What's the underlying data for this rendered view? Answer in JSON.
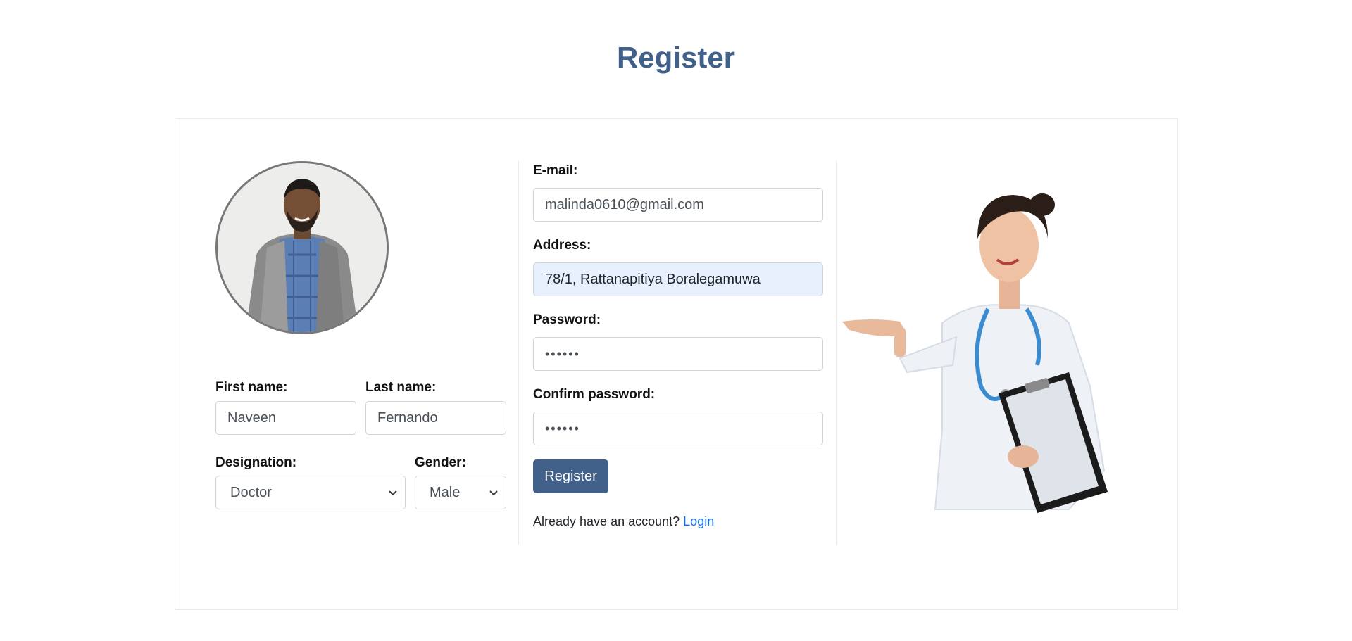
{
  "header": {
    "title": "Register"
  },
  "profile": {
    "first_name_label": "First name:",
    "first_name_value": "Naveen",
    "last_name_label": "Last name:",
    "last_name_value": "Fernando",
    "designation_label": "Designation:",
    "designation_value": "Doctor",
    "gender_label": "Gender:",
    "gender_value": "Male"
  },
  "account": {
    "email_label": "E-mail:",
    "email_value": "malinda0610@gmail.com",
    "address_label": "Address:",
    "address_value": "78/1, Rattanapitiya Boralegamuwa",
    "password_label": "Password:",
    "password_value": "••••••",
    "confirm_label": "Confirm password:",
    "confirm_value": "••••••",
    "register_button": "Register",
    "already_text": "Already have an account?",
    "login_link": "Login"
  },
  "colors": {
    "brand": "#41618a",
    "link": "#0d6efd",
    "autofill": "#e8f0fe"
  }
}
